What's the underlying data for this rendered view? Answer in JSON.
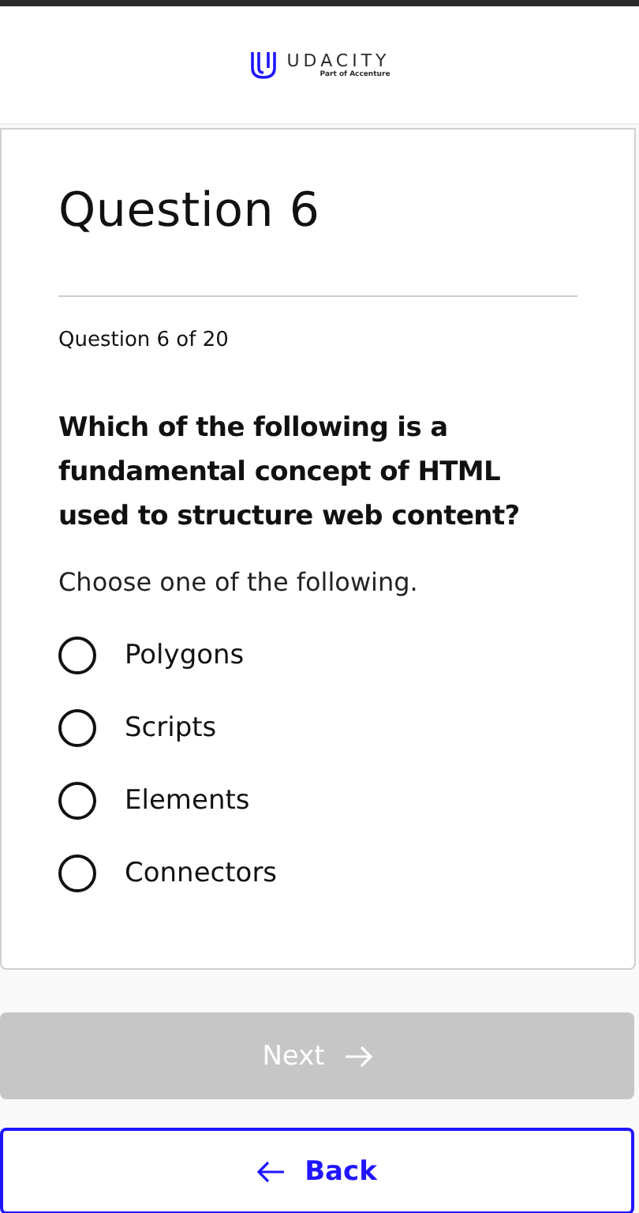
{
  "header": {
    "logo_name": "UDACITY",
    "logo_tagline": "Part of Accenture"
  },
  "quiz": {
    "title": "Question 6",
    "progress": "Question 6 of 20",
    "question": "Which of the following is a fundamental concept of HTML used to structure web content?",
    "instruction": "Choose one of the following.",
    "options": [
      {
        "label": "Polygons",
        "selected": false
      },
      {
        "label": "Scripts",
        "selected": false
      },
      {
        "label": "Elements",
        "selected": false
      },
      {
        "label": "Connectors",
        "selected": false
      }
    ]
  },
  "buttons": [
    {
      "kind": "next",
      "label": "Next",
      "disabled": true
    },
    {
      "kind": "back",
      "label": "Back",
      "disabled": false
    }
  ]
}
